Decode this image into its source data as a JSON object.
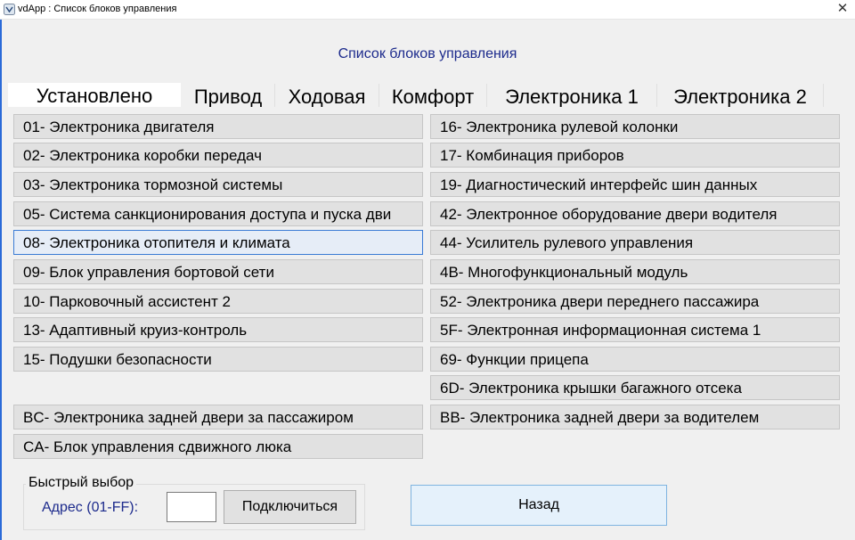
{
  "window": {
    "title": "vdApp : Список блоков управления",
    "close_glyph": "✕"
  },
  "heading": "Список блоков управления",
  "tabs": [
    {
      "label": "Установлено",
      "active": true
    },
    {
      "label": "Привод",
      "active": false
    },
    {
      "label": "Ходовая",
      "active": false
    },
    {
      "label": "Комфорт",
      "active": false
    },
    {
      "label": "Электроника 1",
      "active": false
    },
    {
      "label": "Электроника 2",
      "active": false
    }
  ],
  "modules_left": [
    "01- Электроника двигателя",
    "02- Электроника коробки передач",
    "03- Электроника тормозной системы",
    "05- Система санкционирования доступа и пуска дви",
    "08- Электроника отопителя и климата",
    "09- Блок управления бортовой сети",
    "10- Парковочный ассистент 2",
    "13- Адаптивный круиз-контроль",
    "15- Подушки безопасности",
    "BC- Электроника задней двери за пассажиром",
    "CA- Блок управления сдвижного люка"
  ],
  "modules_right": [
    "16- Электроника рулевой колонки",
    "17- Комбинация приборов",
    "19- Диагностический интерфейс шин данных",
    "42- Электронное оборудование двери водителя",
    "44- Усилитель рулевого управления",
    "4B- Многофункциональный модуль",
    "52- Электроника двери переднего пассажира",
    "5F- Электронная информационная система 1",
    "69- Функции прицепа",
    "6D- Электроника крышки багажного отсека",
    "BB- Электроника задней двери за водителем"
  ],
  "quick_select": {
    "title": "Быстрый выбор",
    "address_label": "Адрес (01-FF):",
    "address_value": "",
    "connect_label": "Подключиться"
  },
  "back_label": "Назад",
  "colors": {
    "accent_text": "#1c2a8c",
    "selected_border": "#3a7bd5",
    "back_button_bg": "#e5f1fb"
  }
}
